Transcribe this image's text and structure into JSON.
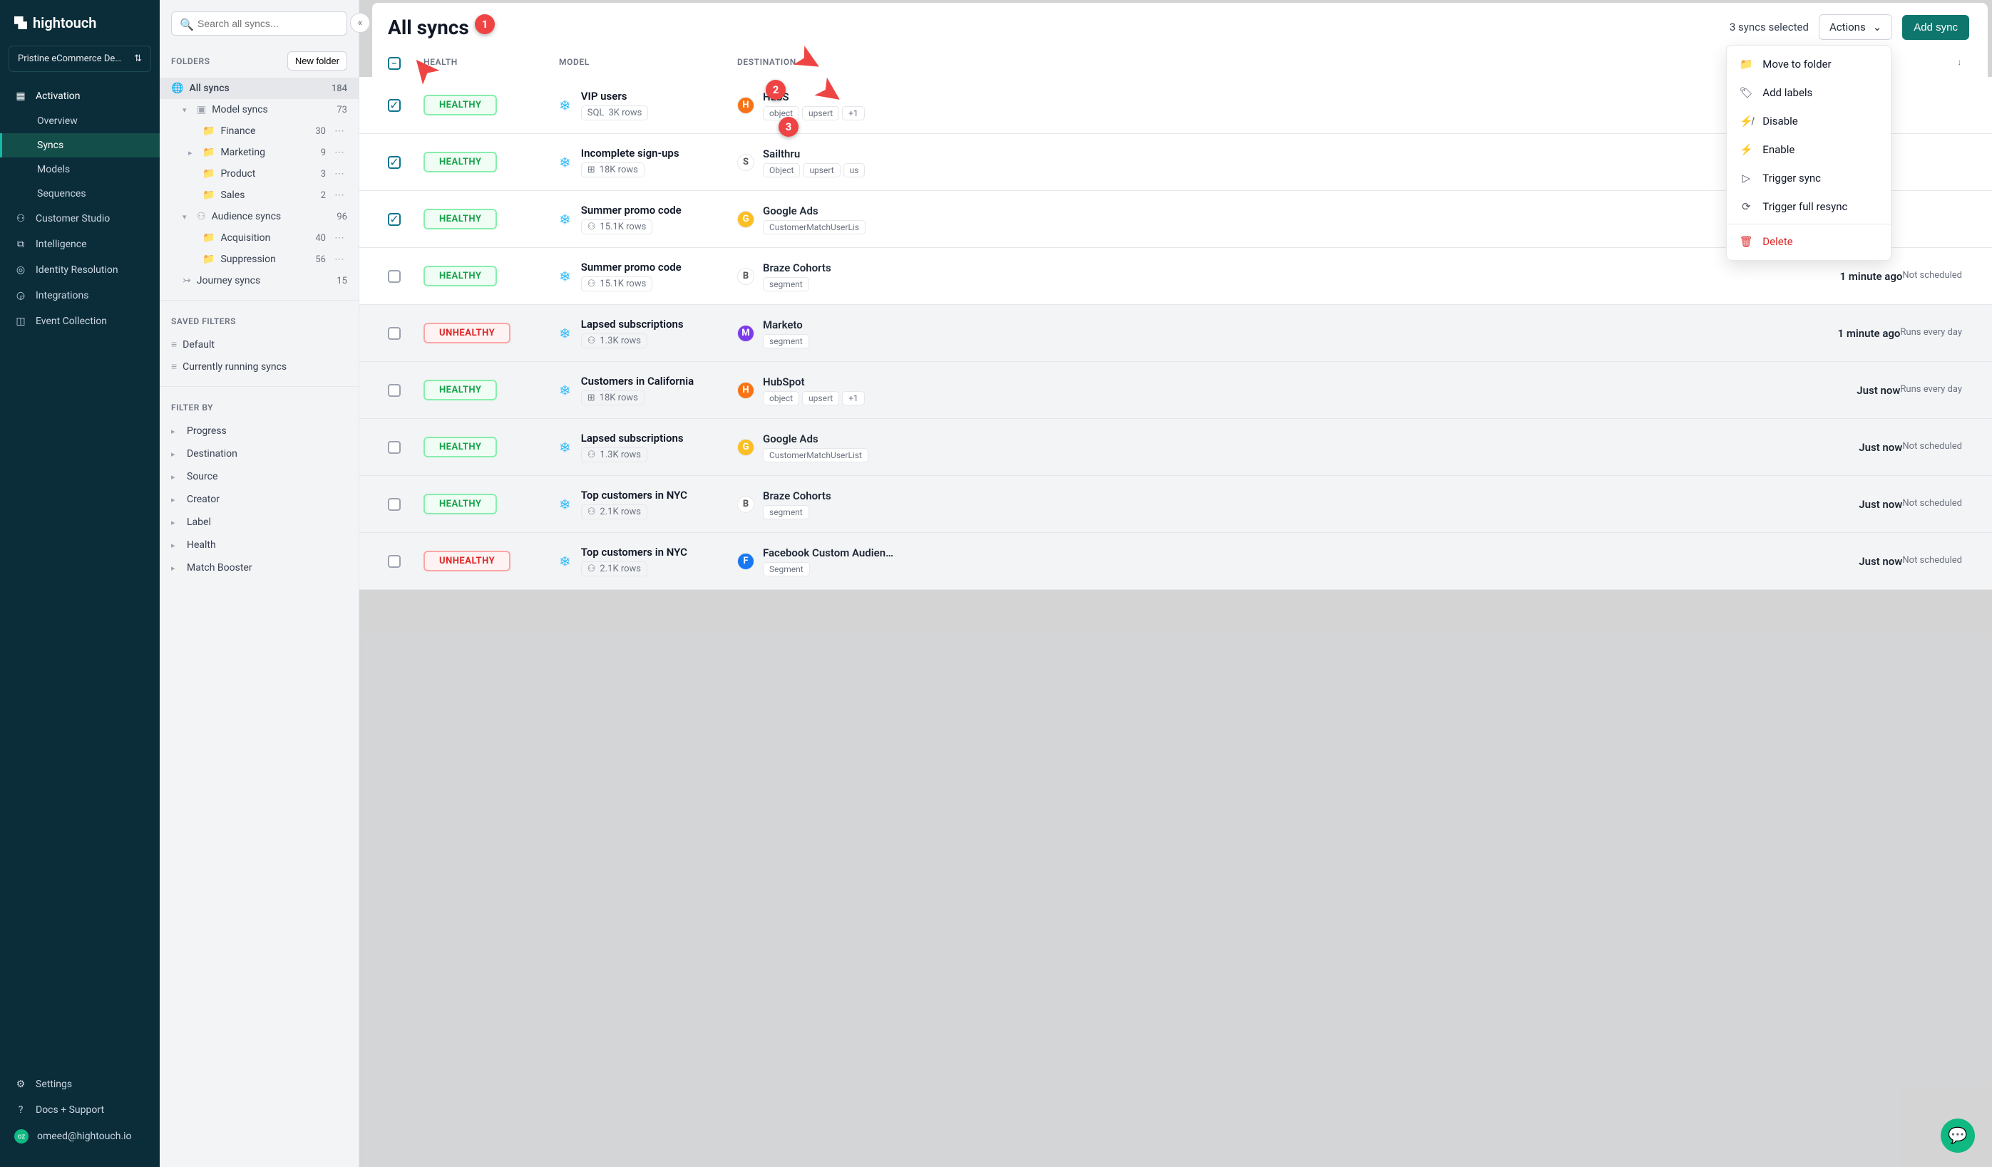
{
  "brand": "hightouch",
  "workspace": "Pristine eCommerce De…",
  "nav": {
    "activation": "Activation",
    "overview": "Overview",
    "syncs": "Syncs",
    "models": "Models",
    "sequences": "Sequences",
    "customerStudio": "Customer Studio",
    "intelligence": "Intelligence",
    "identity": "Identity Resolution",
    "integrations": "Integrations",
    "eventCollection": "Event Collection",
    "settings": "Settings",
    "docs": "Docs + Support",
    "userEmail": "omeed@hightouch.io",
    "userInitials": "oz"
  },
  "search": {
    "placeholder": "Search all syncs..."
  },
  "folders": {
    "title": "FOLDERS",
    "newFolder": "New folder",
    "allSyncs": {
      "label": "All syncs",
      "count": "184"
    },
    "modelSyncs": {
      "label": "Model syncs",
      "count": "73"
    },
    "finance": {
      "label": "Finance",
      "count": "30"
    },
    "marketing": {
      "label": "Marketing",
      "count": "9"
    },
    "product": {
      "label": "Product",
      "count": "3"
    },
    "sales": {
      "label": "Sales",
      "count": "2"
    },
    "audienceSyncs": {
      "label": "Audience syncs",
      "count": "96"
    },
    "acquisition": {
      "label": "Acquisition",
      "count": "40"
    },
    "suppression": {
      "label": "Suppression",
      "count": "56"
    },
    "journeySyncs": {
      "label": "Journey syncs",
      "count": "15"
    }
  },
  "savedFilters": {
    "title": "SAVED FILTERS",
    "default": "Default",
    "running": "Currently running syncs"
  },
  "filterBy": {
    "title": "FILTER BY",
    "progress": "Progress",
    "destination": "Destination",
    "source": "Source",
    "creator": "Creator",
    "label": "Label",
    "health": "Health",
    "matchBooster": "Match Booster"
  },
  "header": {
    "title": "All syncs",
    "selected": "3 syncs selected",
    "actions": "Actions",
    "addSync": "Add sync"
  },
  "dropdown": {
    "moveFolder": "Move to folder",
    "addLabels": "Add labels",
    "disable": "Disable",
    "enable": "Enable",
    "triggerSync": "Trigger sync",
    "triggerFull": "Trigger full resync",
    "delete": "Delete"
  },
  "tableHead": {
    "health": "HEALTH",
    "model": "MODEL",
    "destination": "DESTINATION"
  },
  "rows": [
    {
      "checked": true,
      "health": "HEALTHY",
      "modelName": "VIP users",
      "modelMetaIcon": "SQL",
      "modelMeta": "3K rows",
      "destName": "HubS",
      "destIconBg": "#f97316",
      "tags": [
        "object",
        "upsert",
        "+1"
      ],
      "lastTime": "",
      "lastSched": ""
    },
    {
      "checked": true,
      "health": "HEALTHY",
      "modelName": "Incomplete sign-ups",
      "modelMetaIcon": "⊞",
      "modelMeta": "18K rows",
      "destName": "Sailthru",
      "destIconBg": "#ffffff",
      "tags": [
        "Object",
        "upsert",
        "us"
      ],
      "lastTime": "",
      "lastSched": ""
    },
    {
      "checked": true,
      "health": "HEALTHY",
      "modelName": "Summer promo code",
      "modelMetaIcon": "⚇",
      "modelMeta": "15.1K rows",
      "destName": "Google Ads",
      "destIconBg": "#fbbf24",
      "tags": [
        "CustomerMatchUserLis"
      ],
      "lastTime": "",
      "lastSched": ""
    },
    {
      "checked": false,
      "health": "HEALTHY",
      "modelName": "Summer promo code",
      "modelMetaIcon": "⚇",
      "modelMeta": "15.1K rows",
      "destName": "Braze Cohorts",
      "destIconBg": "#ffffff",
      "tags": [
        "segment"
      ],
      "lastTime": "1 minute ago",
      "lastSched": "Not scheduled"
    },
    {
      "checked": false,
      "health": "UNHEALTHY",
      "modelName": "Lapsed subscriptions",
      "modelMetaIcon": "⚇",
      "modelMeta": "1.3K rows",
      "destName": "Marketo",
      "destIconBg": "#7c3aed",
      "tags": [
        "segment"
      ],
      "lastTime": "1 minute ago",
      "lastSched": "Runs every day"
    },
    {
      "checked": false,
      "health": "HEALTHY",
      "modelName": "Customers in California",
      "modelMetaIcon": "⊞",
      "modelMeta": "18K rows",
      "destName": "HubSpot",
      "destIconBg": "#f97316",
      "tags": [
        "object",
        "upsert",
        "+1"
      ],
      "lastTime": "Just now",
      "lastSched": "Runs every day"
    },
    {
      "checked": false,
      "health": "HEALTHY",
      "modelName": "Lapsed subscriptions",
      "modelMetaIcon": "⚇",
      "modelMeta": "1.3K rows",
      "destName": "Google Ads",
      "destIconBg": "#fbbf24",
      "tags": [
        "CustomerMatchUserList"
      ],
      "lastTime": "Just now",
      "lastSched": "Not scheduled"
    },
    {
      "checked": false,
      "health": "HEALTHY",
      "modelName": "Top customers in NYC",
      "modelMetaIcon": "⚇",
      "modelMeta": "2.1K rows",
      "destName": "Braze Cohorts",
      "destIconBg": "#ffffff",
      "tags": [
        "segment"
      ],
      "lastTime": "Just now",
      "lastSched": "Not scheduled"
    },
    {
      "checked": false,
      "health": "UNHEALTHY",
      "modelName": "Top customers in NYC",
      "modelMetaIcon": "⚇",
      "modelMeta": "2.1K rows",
      "destName": "Facebook Custom Audien…",
      "destIconBg": "#1877f2",
      "tags": [
        "Segment"
      ],
      "lastTime": "Just now",
      "lastSched": "Not scheduled"
    }
  ]
}
